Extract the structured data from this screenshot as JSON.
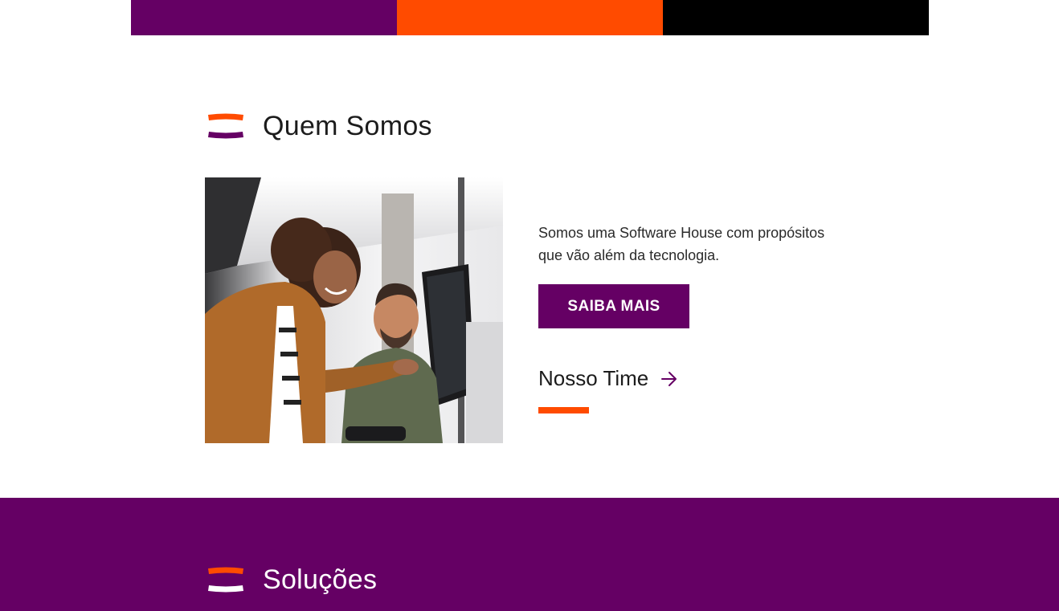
{
  "colors": {
    "purple": "#650064",
    "orange": "#ff4b00",
    "black": "#000000",
    "white": "#ffffff"
  },
  "top_stripe": {
    "segments": [
      "purple",
      "orange",
      "black"
    ]
  },
  "about": {
    "title": "Quem Somos",
    "brand_icon": "brand-mark-icon",
    "photo_alt": "Duas pessoas sorrindo em frente a um computador",
    "description": "Somos uma Software House com propósitos que vão além da tecnologia.",
    "cta_label": "SAIBA MAIS",
    "team_link_label": "Nosso Time",
    "team_link_icon": "arrow-right-icon"
  },
  "solutions": {
    "title": "Soluções",
    "brand_icon": "brand-mark-icon"
  }
}
